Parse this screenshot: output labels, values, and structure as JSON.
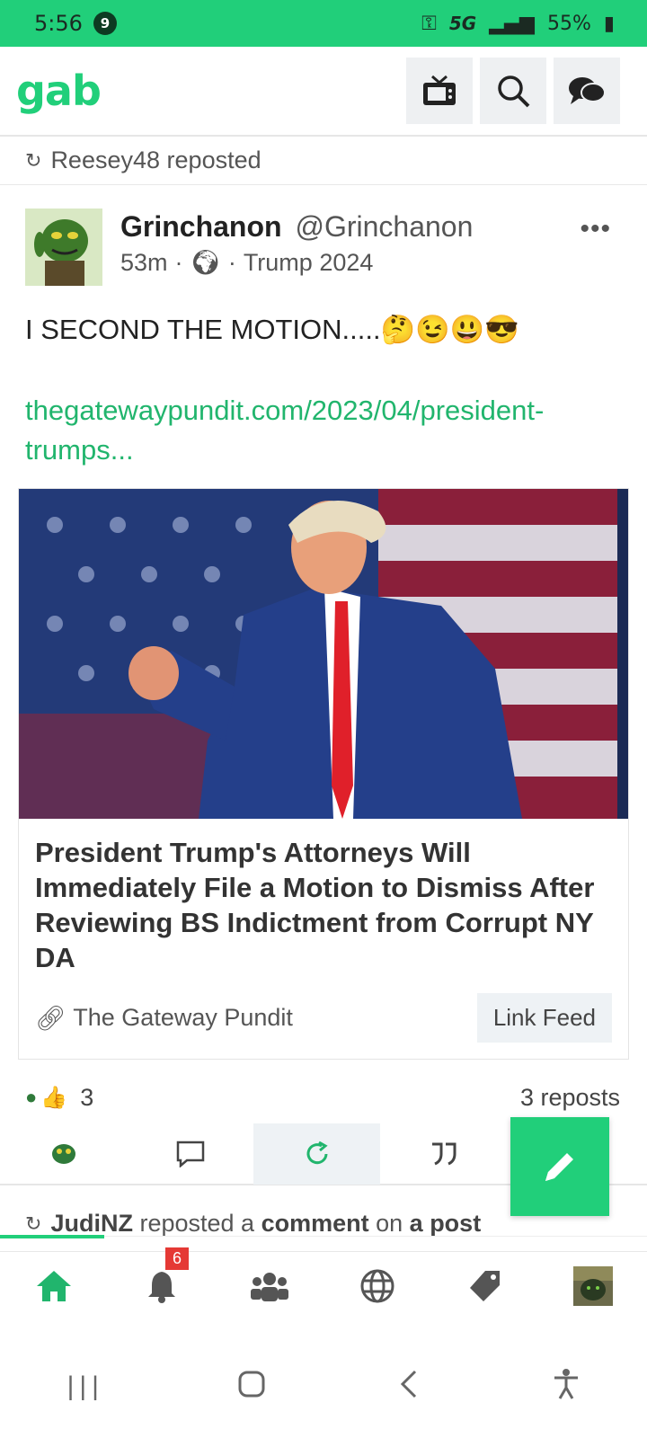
{
  "status_bar": {
    "time": "5:56",
    "notif_count": "9",
    "network": "5G",
    "battery": "55%"
  },
  "app": {
    "logo": "gab"
  },
  "repost_header": {
    "user": "Reesey48",
    "action": "reposted"
  },
  "post": {
    "display_name": "Grinchanon",
    "handle": "@Grinchanon",
    "time": "53m",
    "group": "Trump 2024",
    "more": "•••",
    "text": "I SECOND THE MOTION.....🤔😉😃😎",
    "link_text": "thegatewaypundit.com/2023/04/president-trumps...",
    "card": {
      "title": "President Trump's Attorneys Will Immediately File a Motion to Dismiss After Reviewing BS Indictment from Corrupt NY DA",
      "source": "The Gateway Pundit",
      "link_feed": "Link Feed"
    },
    "reaction_count": "3",
    "reposts": "3 reposts"
  },
  "repost_header2": {
    "user": "JudiNZ",
    "t1": "reposted a",
    "comment": "comment",
    "t2": "on",
    "post": "a post"
  },
  "bottom_nav": {
    "notifications_badge": "6"
  },
  "colors": {
    "brand": "#21cf7a",
    "badge": "#e53935"
  }
}
